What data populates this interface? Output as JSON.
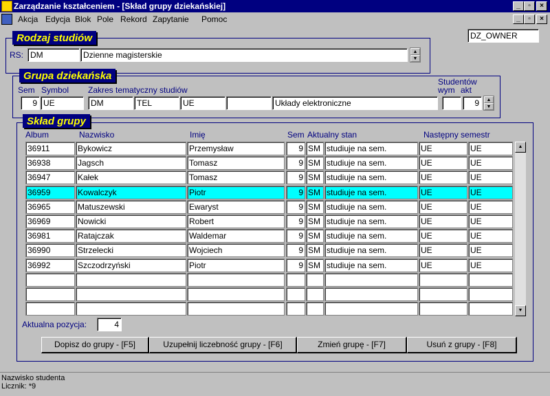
{
  "window": {
    "title": "Zarządzanie kształceniem - [Skład grupy dziekańskiej]"
  },
  "menu": [
    "Akcja",
    "Edycja",
    "Blok",
    "Pole",
    "Rekord",
    "Zapytanie",
    "Pomoc"
  ],
  "owner": "DZ_OWNER",
  "rodzaj": {
    "legend": "Rodzaj studiów",
    "rs_label": "RS:",
    "code": "DM",
    "name": "Dzienne magisterskie"
  },
  "grupa": {
    "legend": "Grupa dziekańska",
    "labels": {
      "sem": "Sem",
      "symbol": "Symbol",
      "zakres": "Zakres tematyczny studiów",
      "studentow": "Studentów",
      "wym": "wym",
      "akt": "akt"
    },
    "sem": "9",
    "symbol": "UE",
    "z1": "DM",
    "z2": "TEL",
    "z3": "UE",
    "z4": "",
    "z5": "Układy elektroniczne",
    "wym": "",
    "akt": "9"
  },
  "sklad": {
    "legend": "Skład grupy",
    "headers": {
      "album": "Album",
      "nazwisko": "Nazwisko",
      "imie": "Imię",
      "sem": "Sem",
      "stan": "Aktualny stan",
      "nastepny": "Następny semestr"
    },
    "rows": [
      {
        "album": "36911",
        "nazwisko": "Bykowicz",
        "imie": "Przemysław",
        "sem": "9",
        "kod": "SM",
        "stan": "studiuje na sem.",
        "n1": "UE",
        "n2": "UE"
      },
      {
        "album": "36938",
        "nazwisko": "Jagsch",
        "imie": "Tomasz",
        "sem": "9",
        "kod": "SM",
        "stan": "studiuje na sem.",
        "n1": "UE",
        "n2": "UE"
      },
      {
        "album": "36947",
        "nazwisko": "Kałek",
        "imie": "Tomasz",
        "sem": "9",
        "kod": "SM",
        "stan": "studiuje na sem.",
        "n1": "UE",
        "n2": "UE"
      },
      {
        "album": "36959",
        "nazwisko": "Kowalczyk",
        "imie": "Piotr",
        "sem": "9",
        "kod": "SM",
        "stan": "studiuje na sem.",
        "n1": "UE",
        "n2": "UE"
      },
      {
        "album": "36965",
        "nazwisko": "Matuszewski",
        "imie": "Ewaryst",
        "sem": "9",
        "kod": "SM",
        "stan": "studiuje na sem.",
        "n1": "UE",
        "n2": "UE"
      },
      {
        "album": "36969",
        "nazwisko": "Nowicki",
        "imie": "Robert",
        "sem": "9",
        "kod": "SM",
        "stan": "studiuje na sem.",
        "n1": "UE",
        "n2": "UE"
      },
      {
        "album": "36981",
        "nazwisko": "Ratajczak",
        "imie": "Waldemar",
        "sem": "9",
        "kod": "SM",
        "stan": "studiuje na sem.",
        "n1": "UE",
        "n2": "UE"
      },
      {
        "album": "36990",
        "nazwisko": "Strzelecki",
        "imie": "Wojciech",
        "sem": "9",
        "kod": "SM",
        "stan": "studiuje na sem.",
        "n1": "UE",
        "n2": "UE"
      },
      {
        "album": "36992",
        "nazwisko": "Szczodrzyński",
        "imie": "Piotr",
        "sem": "9",
        "kod": "SM",
        "stan": "studiuje na sem.",
        "n1": "UE",
        "n2": "UE"
      },
      {
        "album": "",
        "nazwisko": "",
        "imie": "",
        "sem": "",
        "kod": "",
        "stan": "",
        "n1": "",
        "n2": ""
      },
      {
        "album": "",
        "nazwisko": "",
        "imie": "",
        "sem": "",
        "kod": "",
        "stan": "",
        "n1": "",
        "n2": ""
      },
      {
        "album": "",
        "nazwisko": "",
        "imie": "",
        "sem": "",
        "kod": "",
        "stan": "",
        "n1": "",
        "n2": ""
      }
    ],
    "selected_row": 3,
    "pozycja_label": "Aktualna pozycja:",
    "pozycja": "4"
  },
  "buttons": {
    "dopisz": "Dopisz do grupy - [F5]",
    "uzupelnij": "Uzupełnij liczebność grupy - [F6]",
    "zmien": "Zmień grupę - [F7]",
    "usun": "Usuń z grupy - [F8]"
  },
  "status": {
    "line1": "Nazwisko studenta",
    "line2": "Licznik: *9"
  },
  "colors": {
    "title_bg": "#000080",
    "legend_text": "#ffff00",
    "selected_row": "#00ffff"
  }
}
